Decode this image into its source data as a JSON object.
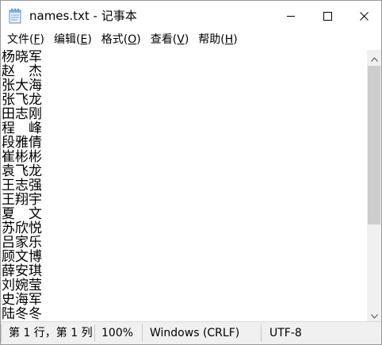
{
  "window": {
    "title": "names.txt - 记事本",
    "app_icon": "notepad-icon",
    "controls": {
      "minimize": "minimize-icon",
      "maximize": "maximize-icon",
      "close": "close-icon"
    }
  },
  "menu": [
    {
      "label": "文件(F)",
      "prefix": "文件(",
      "accel": "F",
      "suffix": ")"
    },
    {
      "label": "编辑(E)",
      "prefix": "编辑(",
      "accel": "E",
      "suffix": ")"
    },
    {
      "label": "格式(O)",
      "prefix": "格式(",
      "accel": "O",
      "suffix": ")"
    },
    {
      "label": "查看(V)",
      "prefix": "查看(",
      "accel": "V",
      "suffix": ")"
    },
    {
      "label": "帮助(H)",
      "prefix": "帮助(",
      "accel": "H",
      "suffix": ")"
    }
  ],
  "document": {
    "lines": [
      "杨晓军",
      "赵　杰",
      "张大海",
      "张飞龙",
      "田志刚",
      "程　峰",
      "段雅倩",
      "崔彬彬",
      "袁飞龙",
      "王志强",
      "王翔宇",
      "夏　文",
      "苏欣悦",
      "吕家乐",
      "顾文博",
      "薛安琪",
      "刘婉莹",
      "史海军",
      "陆冬冬"
    ]
  },
  "scrollbar": {
    "thumb_position": "top"
  },
  "status": {
    "position": "第 1 行，第 1 列",
    "zoom": "100%",
    "line_ending": "Windows (CRLF)",
    "encoding": "UTF-8"
  }
}
